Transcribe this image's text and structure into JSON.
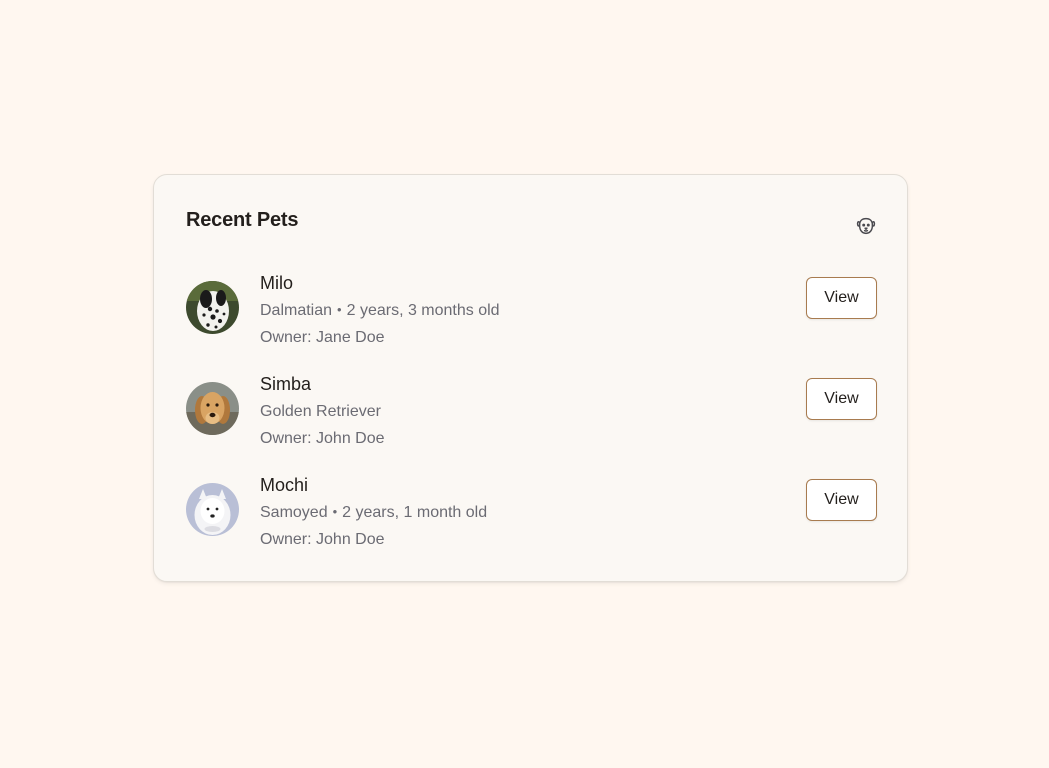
{
  "card": {
    "title": "Recent Pets",
    "header_icon": "dog-face-icon"
  },
  "pets": [
    {
      "name": "Milo",
      "breed": "Dalmatian",
      "age": "2 years, 3 months old",
      "owner": "Owner: Jane Doe",
      "avatar": "dalmatian-photo",
      "action_label": "View"
    },
    {
      "name": "Simba",
      "breed": "Golden Retriever",
      "age": "",
      "owner": "Owner: John Doe",
      "avatar": "golden-retriever-photo",
      "action_label": "View"
    },
    {
      "name": "Mochi",
      "breed": "Samoyed",
      "age": "2 years, 1 month old",
      "owner": "Owner: John Doe",
      "avatar": "samoyed-photo",
      "action_label": "View"
    }
  ],
  "separator": "•",
  "colors": {
    "page_background": "#fff7f0",
    "card_background": "#fbf8f4",
    "button_border": "#a87b4f",
    "muted_text": "#6b6b73"
  }
}
